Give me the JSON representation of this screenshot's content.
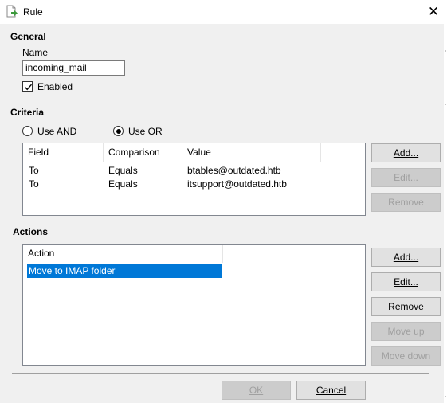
{
  "window": {
    "title": "Rule",
    "close_glyph": "✕",
    "icon": "rule-document-icon"
  },
  "general": {
    "heading": "General",
    "name_label": "Name",
    "name_value": "incoming_mail",
    "enabled_label": "Enabled",
    "enabled_checked": true
  },
  "criteria": {
    "heading": "Criteria",
    "use_and_label": "Use AND",
    "use_or_label": "Use OR",
    "selected": "Use OR",
    "columns": [
      "Field",
      "Comparison",
      "Value"
    ],
    "rows": [
      [
        "To",
        "Equals",
        "btables@outdated.htb"
      ],
      [
        "To",
        "Equals",
        "itsupport@outdated.htb"
      ]
    ],
    "buttons": {
      "add": "Add...",
      "edit": "Edit...",
      "remove": "Remove"
    }
  },
  "actions": {
    "heading": "Actions",
    "column": "Action",
    "rows": [
      "Move to IMAP folder"
    ],
    "selected_row": "Move to IMAP folder",
    "buttons": {
      "add": "Add...",
      "edit": "Edit...",
      "remove": "Remove",
      "move_up": "Move up",
      "move_down": "Move down"
    }
  },
  "footer": {
    "ok": "OK",
    "cancel": "Cancel"
  },
  "colors": {
    "selection": "#0078d7",
    "dialog_bg": "#f0f0f0",
    "button_bg": "#e1e1e1",
    "button_disabled_bg": "#cccccc",
    "disabled_text": "#a0a0a0"
  }
}
